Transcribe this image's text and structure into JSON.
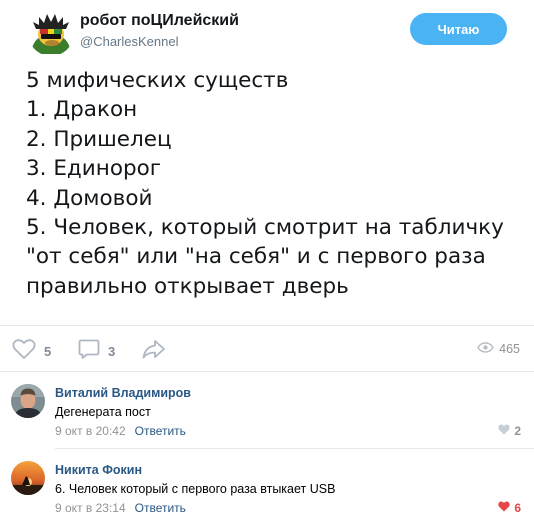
{
  "tweet": {
    "author_name": "робот поЦИлейский",
    "author_handle": "@CharlesKennel",
    "follow_label": "Читаю",
    "follow_color": "#4ab3f4",
    "lines": [
      "5 мифических существ",
      "1. Дракон",
      "2. Пришелец",
      "3. Единорог",
      "4. Домовой",
      "5. Человек, который смотрит на табличку",
      "\"от себя\" или \"на себя\" и с первого раза",
      "правильно открывает дверь"
    ]
  },
  "actions": {
    "like_icon": "heart-outline-icon",
    "likes": "5",
    "comment_icon": "comment-icon",
    "comments": "3",
    "share_icon": "share-arrow-icon",
    "view_icon": "eye-icon",
    "views": "465"
  },
  "comments": [
    {
      "author": "Виталий Владимиров",
      "text": "Дегенерата пост",
      "date": "9 окт в 20:42",
      "reply_label": "Ответить",
      "likes": "2",
      "liked": false
    },
    {
      "author": "Никита Фокин",
      "text": "6. Человек который с первого раза втыкает USB",
      "date": "9 окт в 23:14",
      "reply_label": "Ответить",
      "likes": "6",
      "liked": true
    }
  ],
  "colors": {
    "link": "#2a5885",
    "muted": "#939393",
    "liked": "#e64646"
  }
}
